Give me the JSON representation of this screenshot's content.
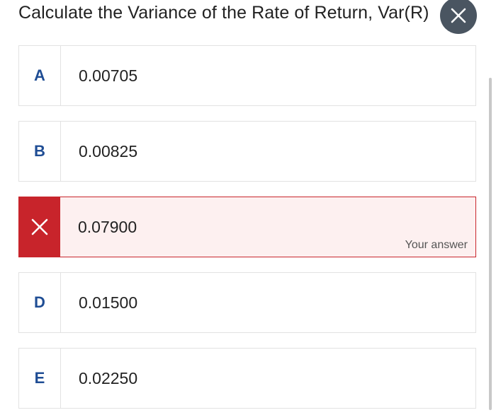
{
  "question": {
    "text": "Calculate the Variance of the Rate of Return, Var(R)"
  },
  "close_button": {
    "icon": "close-icon"
  },
  "options": [
    {
      "letter": "A",
      "value": "0.00705",
      "state": "default"
    },
    {
      "letter": "B",
      "value": "0.00825",
      "state": "default"
    },
    {
      "letter": "",
      "value": "0.07900",
      "state": "incorrect",
      "icon": "x-mark-icon",
      "note": "Your answer"
    },
    {
      "letter": "D",
      "value": "0.01500",
      "state": "default"
    },
    {
      "letter": "E",
      "value": "0.02250",
      "state": "default"
    }
  ],
  "colors": {
    "accent_letter": "#1f4d94",
    "incorrect": "#c8242b",
    "incorrect_bg": "#fdf0f0",
    "close_bg": "#4a5561"
  }
}
